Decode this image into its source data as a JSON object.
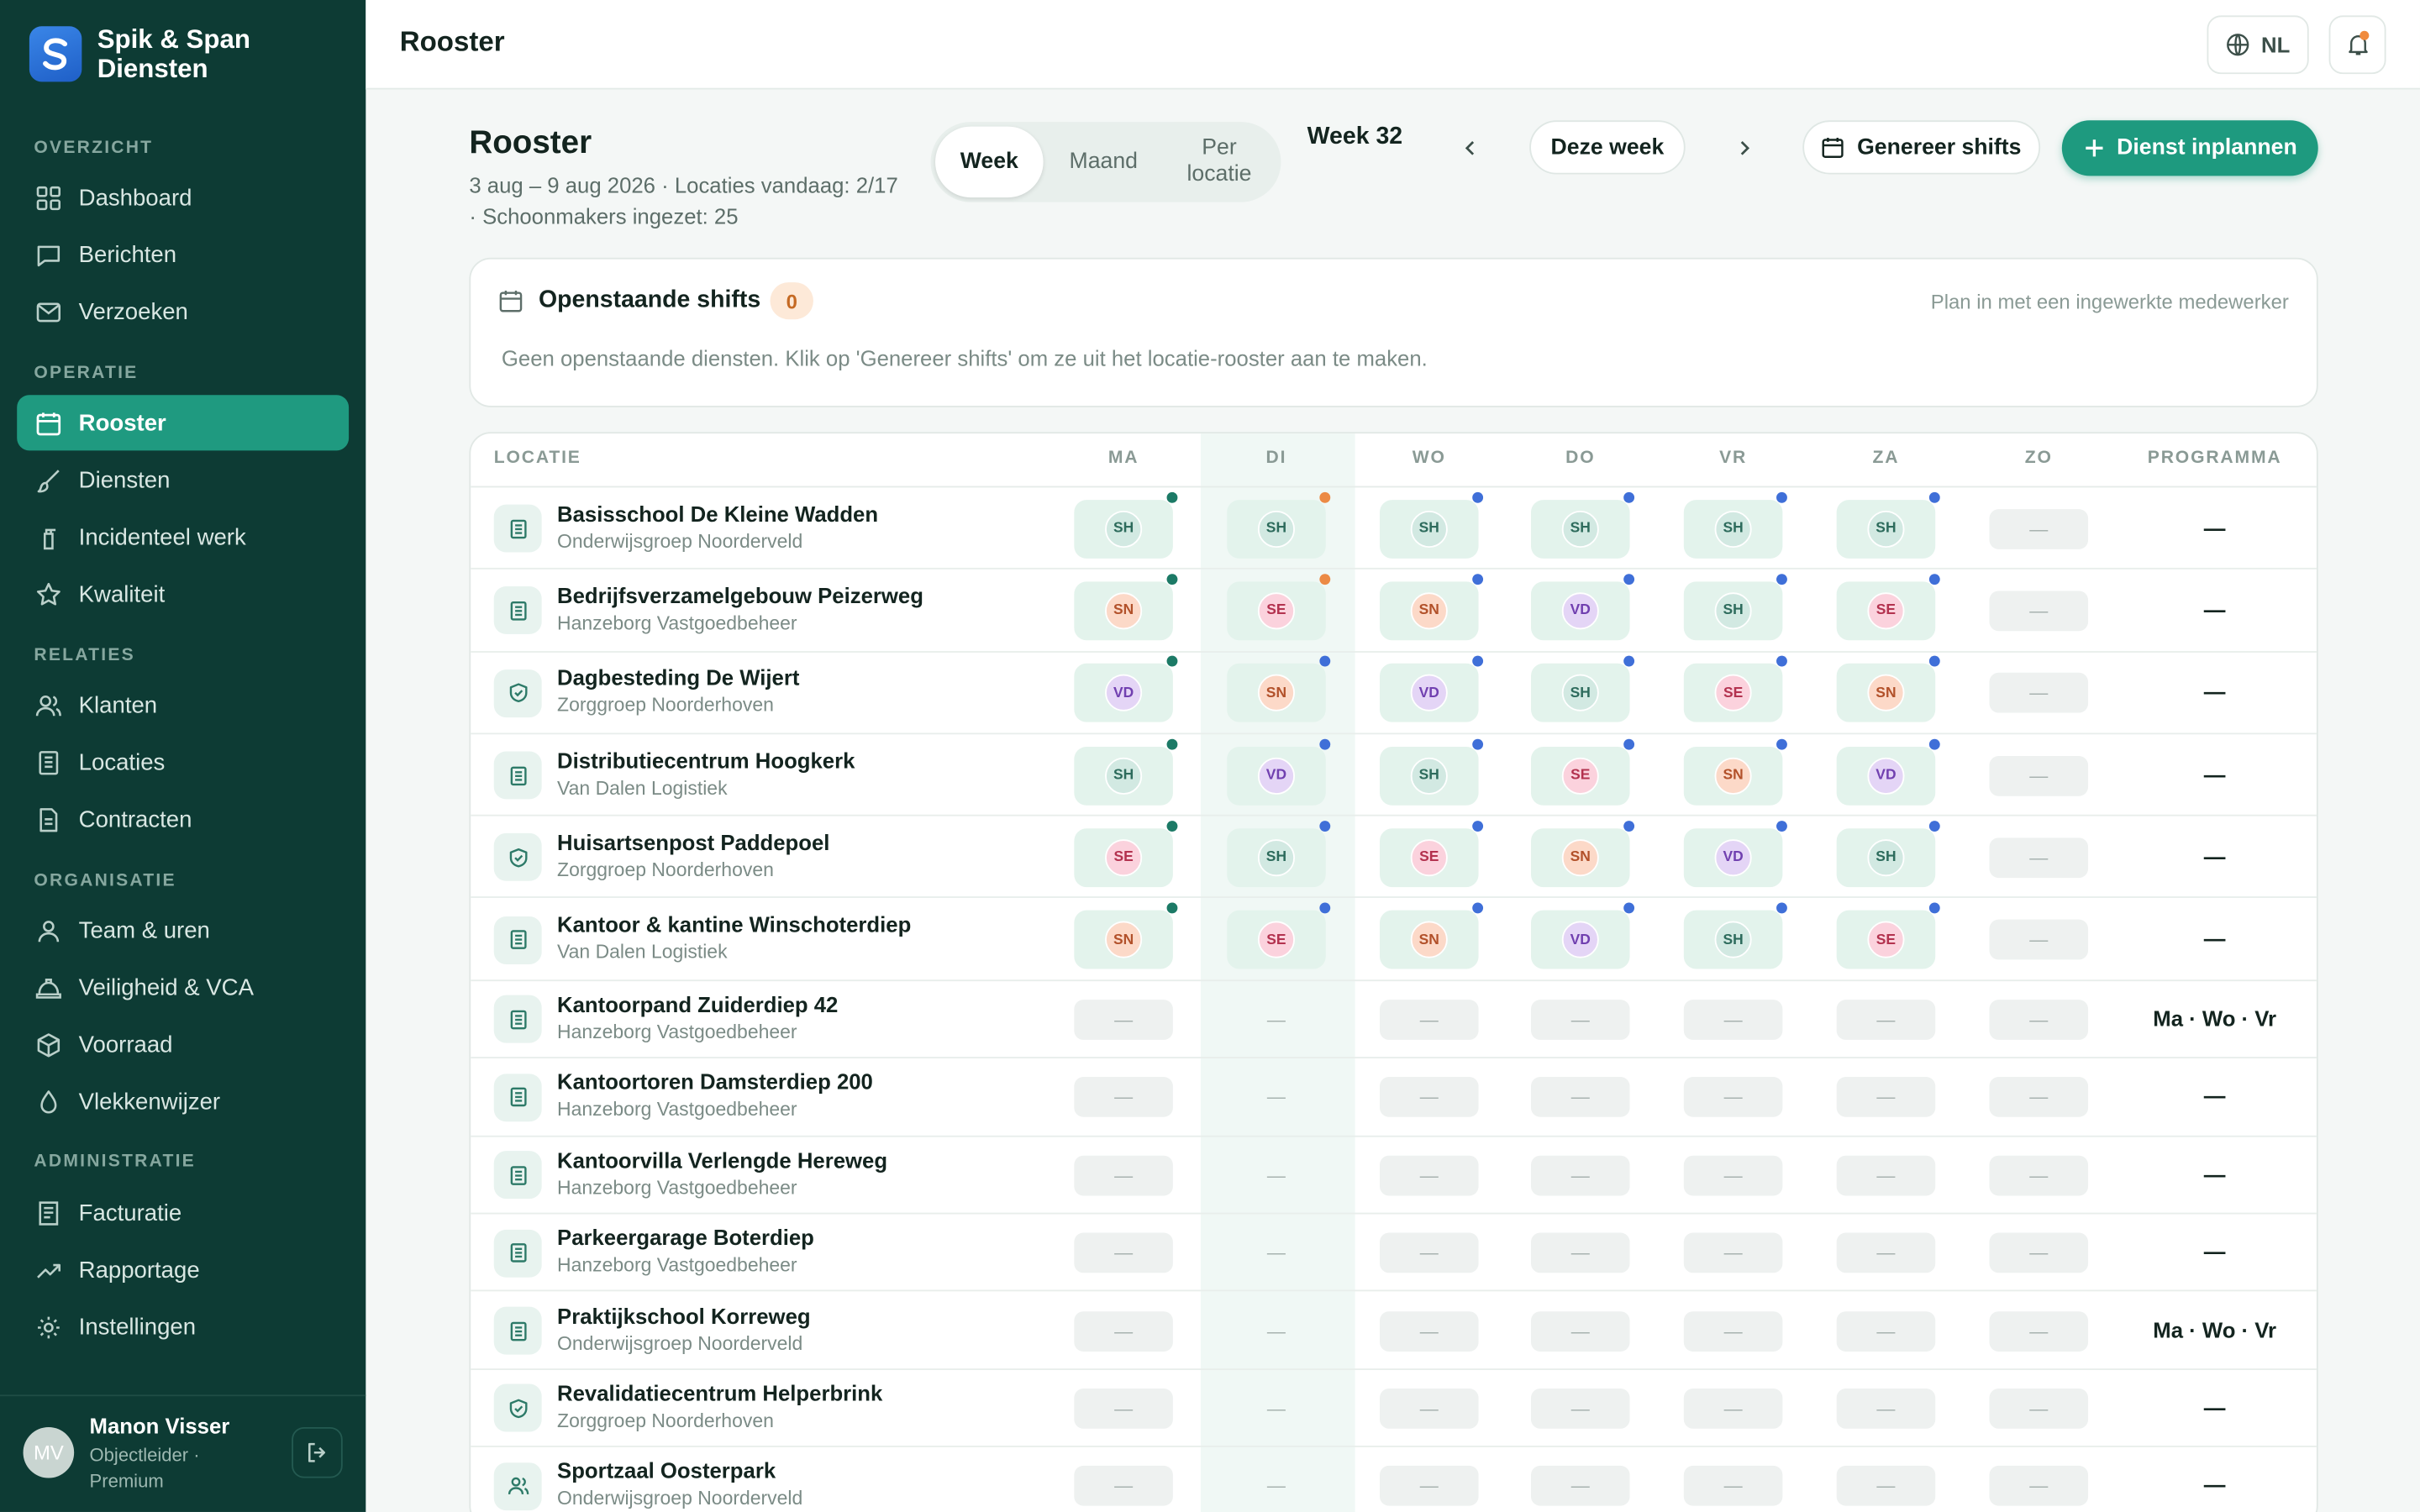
{
  "app": {
    "name": "Spik & Span Diensten"
  },
  "sidebar": {
    "sections": {
      "overzicht": "OVERZICHT",
      "operatie": "OPERATIE",
      "relaties": "RELATIES",
      "organisatie": "ORGANISATIE",
      "administratie": "ADMINISTRATIE"
    },
    "items": {
      "dashboard": "Dashboard",
      "berichten": "Berichten",
      "verzoeken": "Verzoeken",
      "rooster": "Rooster",
      "diensten": "Diensten",
      "incidenteel": "Incidenteel werk",
      "kwaliteit": "Kwaliteit",
      "klanten": "Klanten",
      "locaties": "Locaties",
      "contracten": "Contracten",
      "team": "Team & uren",
      "veiligheid": "Veiligheid & VCA",
      "voorraad": "Voorraad",
      "vlekkenwijzer": "Vlekkenwijzer",
      "facturatie": "Facturatie",
      "rapportage": "Rapportage",
      "instellingen": "Instellingen"
    },
    "active": "rooster",
    "user": {
      "initials": "MV",
      "name": "Manon Visser",
      "role": "Objectleider · Premium"
    }
  },
  "topbar": {
    "title": "Rooster",
    "language": "NL"
  },
  "header": {
    "title": "Rooster",
    "meta": "3 aug – 9 aug 2026 · Locaties vandaag: 2/17 · Schoonmakers ingezet: 25",
    "view_tabs": [
      "Week",
      "Maand",
      "Per locatie"
    ],
    "active_view": "Week",
    "week_label": "Week 32",
    "this_week": "Deze week",
    "generate": "Genereer shifts",
    "plan": "Dienst inplannen"
  },
  "open_shifts": {
    "title": "Openstaande shifts",
    "count": "0",
    "hint": "Plan in met een ingewerkte medewerker",
    "empty": "Geen openstaande diensten. Klik op 'Genereer shifts' om ze uit het locatie-rooster aan te maken."
  },
  "table": {
    "headers": {
      "location": "LOCATIE",
      "days": [
        "MA",
        "DI",
        "WO",
        "DO",
        "VR",
        "ZA",
        "ZO"
      ],
      "program": "PROGRAMMA"
    },
    "empty_cell": "—",
    "initials_colors": {
      "SH": {
        "bg": "#d2e9e2",
        "fg": "#2d6b5c"
      },
      "SN": {
        "bg": "#fcd9c8",
        "fg": "#b2512a"
      },
      "SE": {
        "bg": "#fbd2dd",
        "fg": "#b3324f"
      },
      "VD": {
        "bg": "#e4d5f6",
        "fg": "#7140b0"
      }
    },
    "dot_colors": {
      "green": "#1c7a66",
      "orange": "#ec8a45",
      "blue": "#3f6fd8"
    },
    "rows": [
      {
        "name": "Basisschool De Kleine Wadden",
        "client": "Onderwijsgroep Noorderveld",
        "icon": "document-icon",
        "days": [
          "SH",
          "SH",
          "SH",
          "SH",
          "SH",
          "SH",
          null
        ],
        "dots": [
          "green",
          "orange",
          "blue",
          "blue",
          "blue",
          "blue",
          null
        ],
        "program": "—"
      },
      {
        "name": "Bedrijfsverzamelgebouw Peizerweg",
        "client": "Hanzeborg Vastgoedbeheer",
        "icon": "document-icon",
        "days": [
          "SN",
          "SE",
          "SN",
          "VD",
          "SH",
          "SE",
          null
        ],
        "dots": [
          "green",
          "orange",
          "blue",
          "blue",
          "blue",
          "blue",
          null
        ],
        "program": "—"
      },
      {
        "name": "Dagbesteding De Wijert",
        "client": "Zorggroep Noorderhoven",
        "icon": "shield-icon",
        "days": [
          "VD",
          "SN",
          "VD",
          "SH",
          "SE",
          "SN",
          null
        ],
        "dots": [
          "green",
          "blue",
          "blue",
          "blue",
          "blue",
          "blue",
          null
        ],
        "program": "—"
      },
      {
        "name": "Distributiecentrum Hoogkerk",
        "client": "Van Dalen Logistiek",
        "icon": "document-icon",
        "days": [
          "SH",
          "VD",
          "SH",
          "SE",
          "SN",
          "VD",
          null
        ],
        "dots": [
          "green",
          "blue",
          "blue",
          "blue",
          "blue",
          "blue",
          null
        ],
        "program": "—"
      },
      {
        "name": "Huisartsenpost Paddepoel",
        "client": "Zorggroep Noorderhoven",
        "icon": "shield-icon",
        "days": [
          "SE",
          "SH",
          "SE",
          "SN",
          "VD",
          "SH",
          null
        ],
        "dots": [
          "green",
          "blue",
          "blue",
          "blue",
          "blue",
          "blue",
          null
        ],
        "program": "—"
      },
      {
        "name": "Kantoor & kantine Winschoterdiep",
        "client": "Van Dalen Logistiek",
        "icon": "document-icon",
        "days": [
          "SN",
          "SE",
          "SN",
          "VD",
          "SH",
          "SE",
          null
        ],
        "dots": [
          "green",
          "blue",
          "blue",
          "blue",
          "blue",
          "blue",
          null
        ],
        "program": "—"
      },
      {
        "name": "Kantoorpand Zuiderdiep 42",
        "client": "Hanzeborg Vastgoedbeheer",
        "icon": "document-icon",
        "days": [
          null,
          null,
          null,
          null,
          null,
          null,
          null
        ],
        "program": "Ma · Wo · Vr"
      },
      {
        "name": "Kantoortoren Damsterdiep 200",
        "client": "Hanzeborg Vastgoedbeheer",
        "icon": "document-icon",
        "days": [
          null,
          null,
          null,
          null,
          null,
          null,
          null
        ],
        "program": "—"
      },
      {
        "name": "Kantoorvilla Verlengde Hereweg",
        "client": "Hanzeborg Vastgoedbeheer",
        "icon": "document-icon",
        "days": [
          null,
          null,
          null,
          null,
          null,
          null,
          null
        ],
        "program": "—"
      },
      {
        "name": "Parkeergarage Boterdiep",
        "client": "Hanzeborg Vastgoedbeheer",
        "icon": "document-icon",
        "days": [
          null,
          null,
          null,
          null,
          null,
          null,
          null
        ],
        "program": "—"
      },
      {
        "name": "Praktijkschool Korreweg",
        "client": "Onderwijsgroep Noorderveld",
        "icon": "document-icon",
        "days": [
          null,
          null,
          null,
          null,
          null,
          null,
          null
        ],
        "program": "Ma · Wo · Vr"
      },
      {
        "name": "Revalidatiecentrum Helperbrink",
        "client": "Zorggroep Noorderhoven",
        "icon": "shield-icon",
        "days": [
          null,
          null,
          null,
          null,
          null,
          null,
          null
        ],
        "program": "—"
      },
      {
        "name": "Sportzaal Oosterpark",
        "client": "Onderwijsgroep Noorderveld",
        "icon": "users-icon",
        "days": [
          null,
          null,
          null,
          null,
          null,
          null,
          null
        ],
        "program": "—"
      }
    ]
  }
}
